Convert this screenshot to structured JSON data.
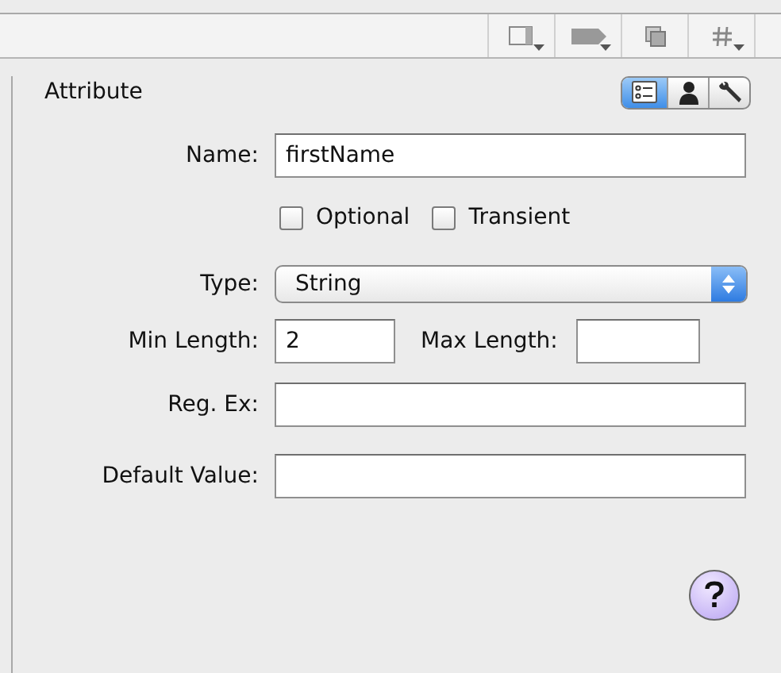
{
  "toolbar": {
    "buttons": [
      {
        "kind": "panel",
        "menu": true
      },
      {
        "kind": "tag",
        "menu": true
      },
      {
        "kind": "copy",
        "menu": false
      },
      {
        "kind": "hash",
        "menu": true
      }
    ]
  },
  "panel": {
    "title": "Attribute",
    "view_tabs": [
      {
        "kind": "list",
        "selected": true
      },
      {
        "kind": "person",
        "selected": false
      },
      {
        "kind": "wrench",
        "selected": false
      }
    ],
    "name": {
      "label": "Name:",
      "value": "firstName"
    },
    "options": [
      {
        "label": "Optional",
        "checked": false
      },
      {
        "label": "Transient",
        "checked": false
      }
    ],
    "type": {
      "label": "Type:",
      "value": "String"
    },
    "min_length": {
      "label": "Min Length:",
      "value": "2"
    },
    "max_length": {
      "label": "Max Length:"
    },
    "reg_ex": {
      "label": "Reg. Ex:"
    },
    "default_value": {
      "label": "Default Value:"
    }
  }
}
